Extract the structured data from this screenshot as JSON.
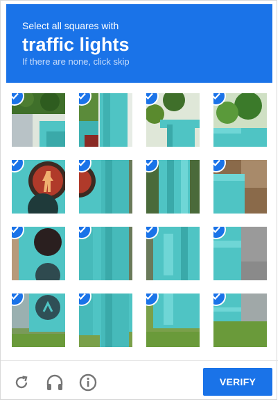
{
  "header": {
    "instruction": "Select all squares with",
    "target": "traffic lights",
    "hint": "If there are none, click skip"
  },
  "grid": {
    "rows": 4,
    "cols": 4,
    "tiles": [
      {
        "index": 0,
        "selected": true,
        "icon": "check-icon"
      },
      {
        "index": 1,
        "selected": true,
        "icon": "check-icon"
      },
      {
        "index": 2,
        "selected": true,
        "icon": "check-icon"
      },
      {
        "index": 3,
        "selected": true,
        "icon": "check-icon"
      },
      {
        "index": 4,
        "selected": true,
        "icon": "check-icon"
      },
      {
        "index": 5,
        "selected": true,
        "icon": "check-icon"
      },
      {
        "index": 6,
        "selected": true,
        "icon": "check-icon"
      },
      {
        "index": 7,
        "selected": true,
        "icon": "check-icon"
      },
      {
        "index": 8,
        "selected": true,
        "icon": "check-icon"
      },
      {
        "index": 9,
        "selected": true,
        "icon": "check-icon"
      },
      {
        "index": 10,
        "selected": true,
        "icon": "check-icon"
      },
      {
        "index": 11,
        "selected": true,
        "icon": "check-icon"
      },
      {
        "index": 12,
        "selected": true,
        "icon": "check-icon"
      },
      {
        "index": 13,
        "selected": true,
        "icon": "check-icon"
      },
      {
        "index": 14,
        "selected": true,
        "icon": "check-icon"
      },
      {
        "index": 15,
        "selected": true,
        "icon": "check-icon"
      }
    ]
  },
  "footer": {
    "icons": [
      "reload-icon",
      "headphones-icon",
      "info-icon"
    ],
    "verify_label": "VERIFY"
  },
  "colors": {
    "accent": "#1a73e8",
    "hint_text": "#c7dcfb",
    "icon_gray": "#757575",
    "signal_teal": "#4fc4c4",
    "foliage": "#5a8a2e"
  }
}
